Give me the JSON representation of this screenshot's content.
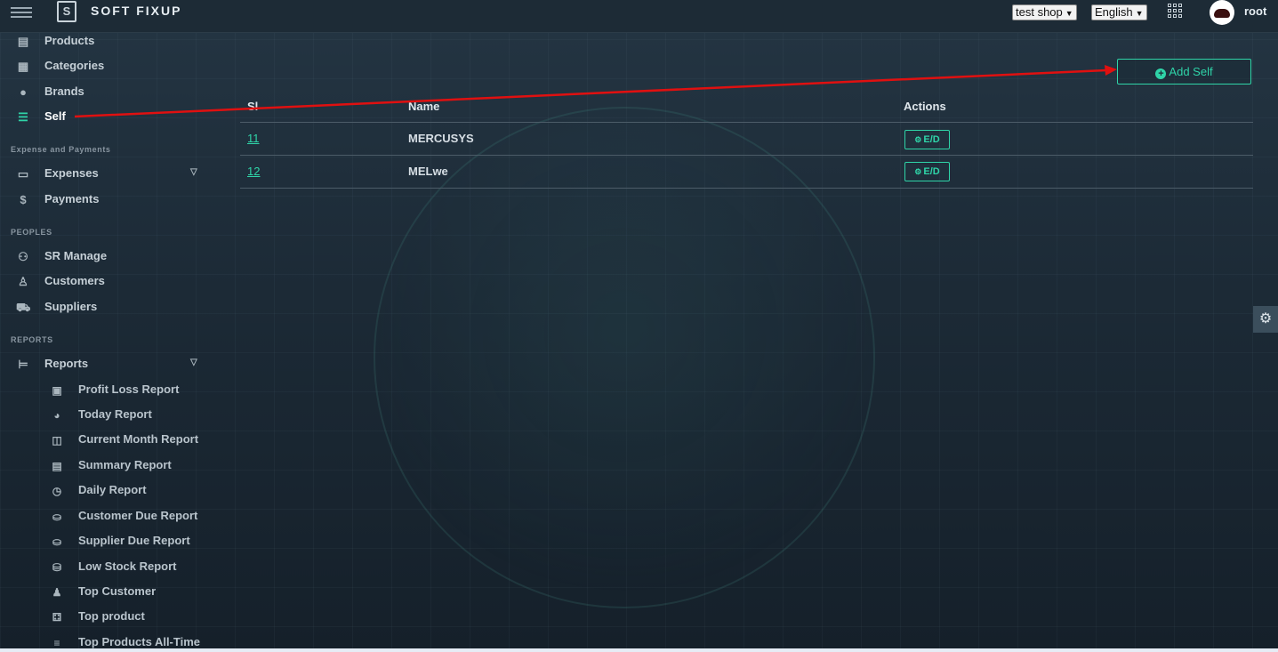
{
  "brand": {
    "name": "SOFT FIXUP",
    "logo_letter": "S"
  },
  "header": {
    "shop_select": "test shop",
    "language_select": "English",
    "username": "root"
  },
  "sidebar": {
    "top_items": [
      {
        "label": "Products",
        "icon": "products-icon"
      },
      {
        "label": "Categories",
        "icon": "grid-icon"
      },
      {
        "label": "Brands",
        "icon": "brands-icon"
      },
      {
        "label": "Self",
        "icon": "shelf-icon",
        "active": true
      }
    ],
    "section_expense": "Expense and Payments",
    "expense_items": [
      {
        "label": "Expenses",
        "icon": "wallet-icon",
        "has_submenu": true
      },
      {
        "label": "Payments",
        "icon": "dollar-icon"
      }
    ],
    "section_peoples": "PEOPLES",
    "people_items": [
      {
        "label": "SR Manage",
        "icon": "users-icon"
      },
      {
        "label": "Customers",
        "icon": "customer-icon"
      },
      {
        "label": "Suppliers",
        "icon": "truck-icon"
      }
    ],
    "section_reports": "REPORTS",
    "reports_item": {
      "label": "Reports",
      "icon": "report-icon",
      "has_submenu": true
    },
    "report_items": [
      {
        "label": "Profit Loss Report",
        "icon": "profit-icon"
      },
      {
        "label": "Today Report",
        "icon": "clock-icon"
      },
      {
        "label": "Current Month Report",
        "icon": "calendar-icon"
      },
      {
        "label": "Summary Report",
        "icon": "document-icon"
      },
      {
        "label": "Daily Report",
        "icon": "clock-outline-icon"
      },
      {
        "label": "Customer Due Report",
        "icon": "coins-icon"
      },
      {
        "label": "Supplier Due Report",
        "icon": "coins-icon"
      },
      {
        "label": "Low Stock Report",
        "icon": "database-icon"
      },
      {
        "label": "Top Customer",
        "icon": "user-star-icon"
      },
      {
        "label": "Top product",
        "icon": "boxes-icon"
      },
      {
        "label": "Top Products All-Time",
        "icon": "list-icon"
      }
    ]
  },
  "main": {
    "add_button_label": "Add Self",
    "table": {
      "columns": [
        "Sl",
        "Name",
        "Actions"
      ],
      "rows": [
        {
          "sl": "11",
          "name": "MERCUSYS",
          "action": "E/D"
        },
        {
          "sl": "12",
          "name": "MELwe",
          "action": "E/D"
        }
      ]
    }
  },
  "colors": {
    "accent": "#2fd4a8",
    "annotation_arrow": "#e01010",
    "background": "#1c2a36"
  }
}
